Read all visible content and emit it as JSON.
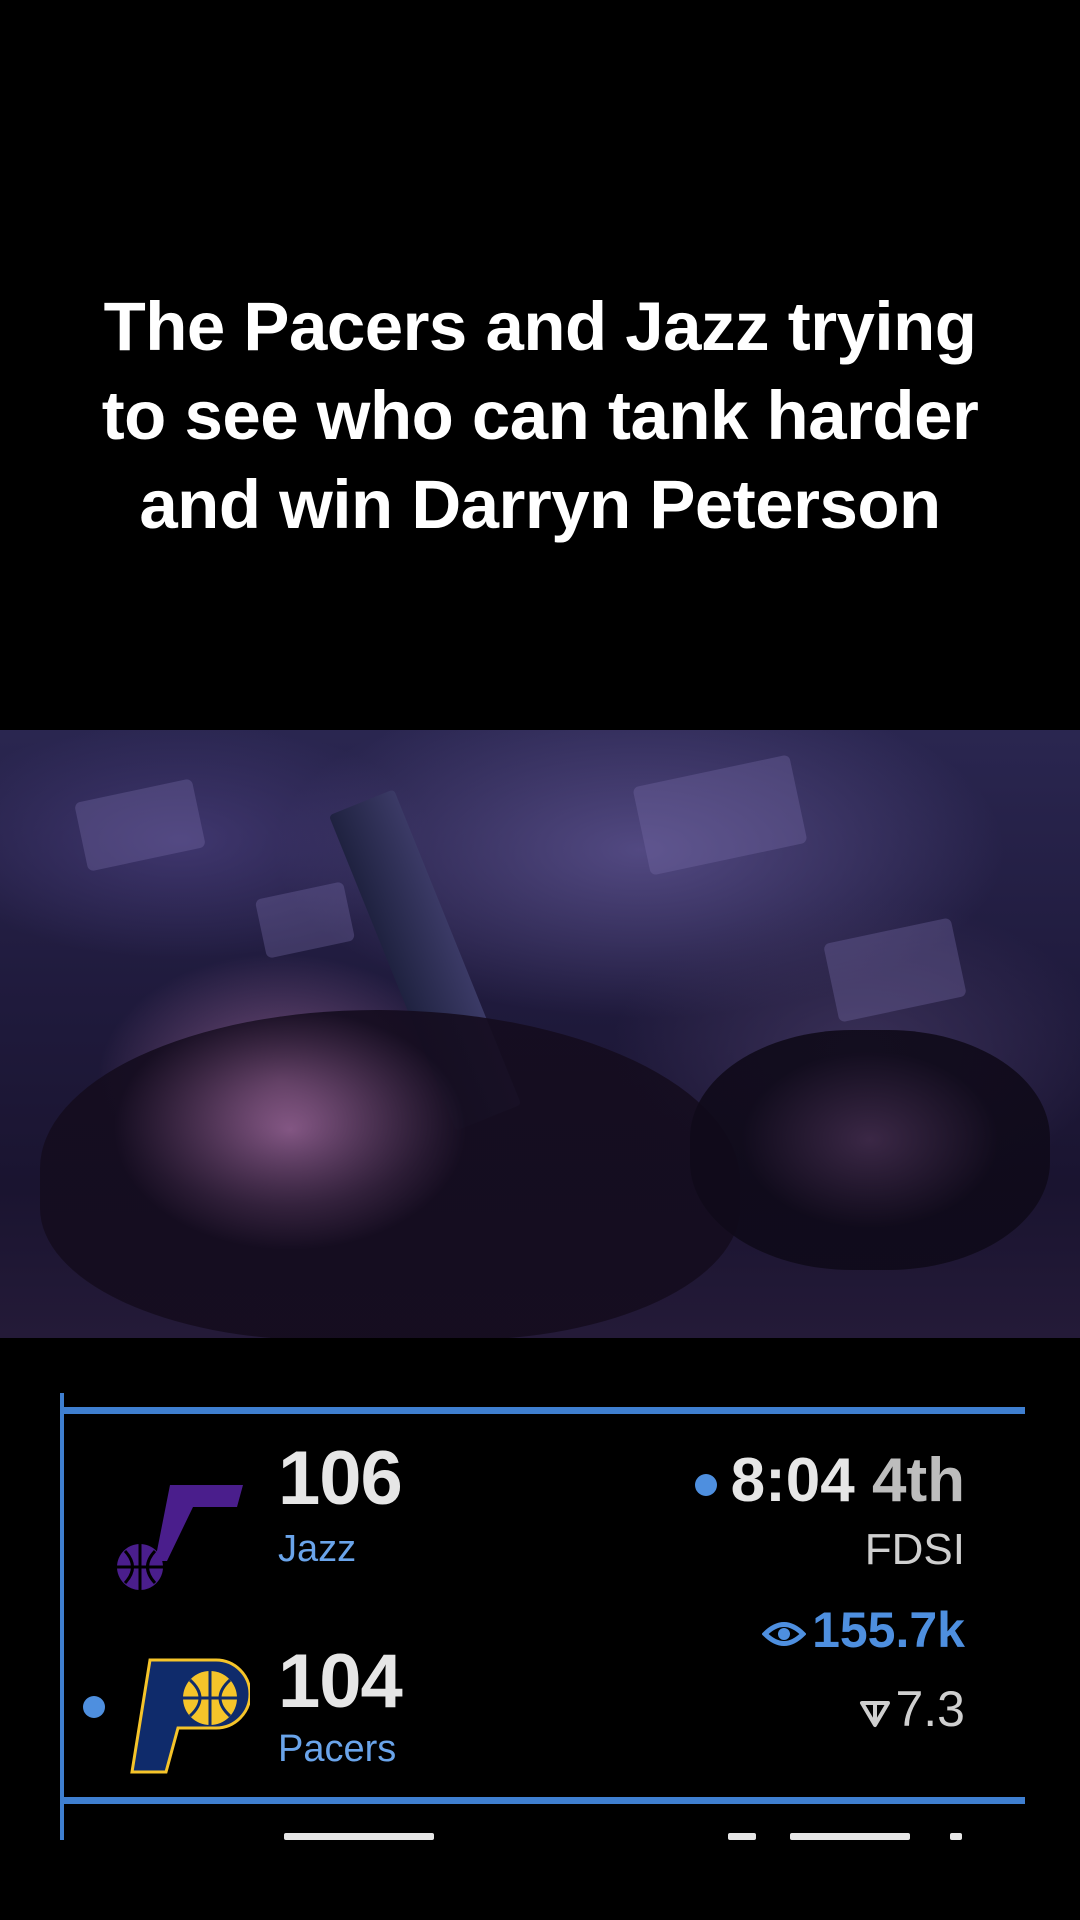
{
  "caption": {
    "lines": [
      "The Pacers and Jazz trying",
      "to see who can tank harder",
      "and win Darryn Peterson"
    ]
  },
  "scoreboard": {
    "teams": [
      {
        "name": "Jazz",
        "score": "106",
        "has_possession": false,
        "logo_icon": "jazz-note-logo-icon"
      },
      {
        "name": "Pacers",
        "score": "104",
        "has_possession": true,
        "logo_icon": "pacers-p-logo-icon"
      }
    ],
    "clock": "8:04",
    "period": "4th",
    "network": "FDSI",
    "viewers": "155.7k",
    "rating": "7.3",
    "live_indicator_icon": "live-dot-icon",
    "viewers_icon": "eye-icon",
    "rating_icon": "rating-icon"
  },
  "colors": {
    "accent_blue": "#3f7fd0",
    "jazz_purple": "#4a1e8c",
    "pacers_navy": "#0f2b6b",
    "pacers_gold": "#f5c42a"
  }
}
